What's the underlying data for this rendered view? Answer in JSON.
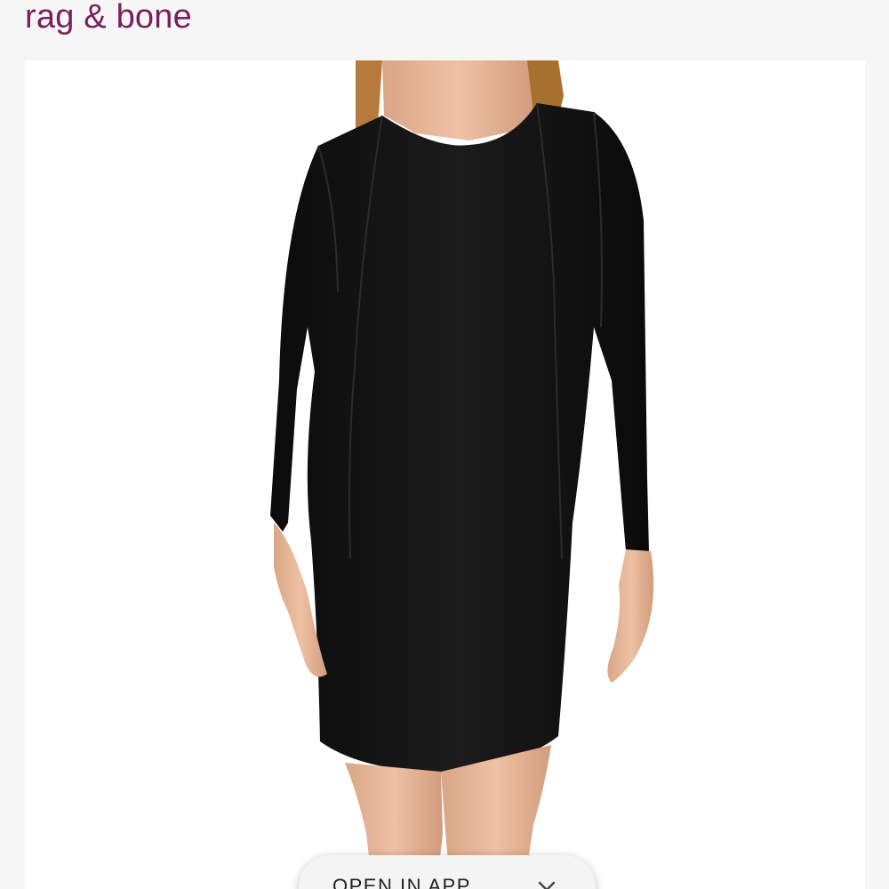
{
  "brand": {
    "name": "rag & bone",
    "color": "#7a1f5c"
  },
  "product_image": {
    "icon": "product-photo-icon"
  },
  "app_banner": {
    "label": "OPEN IN APP",
    "close_icon": "chevron-down-icon"
  }
}
